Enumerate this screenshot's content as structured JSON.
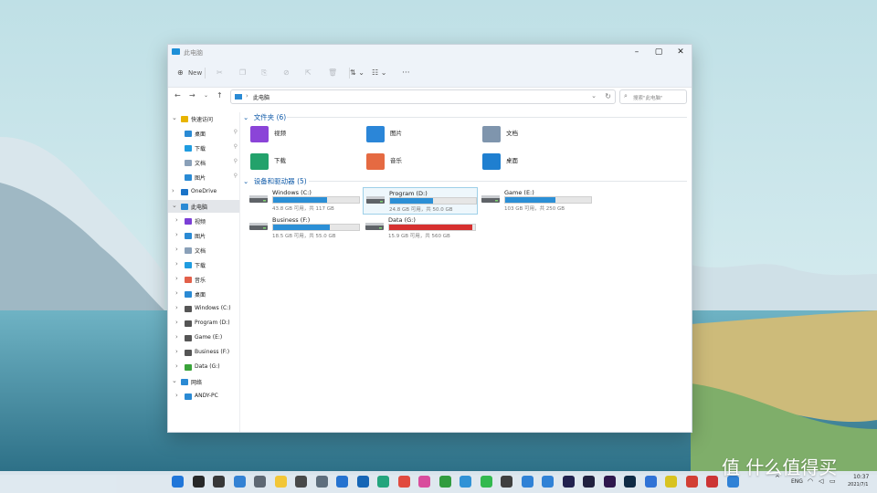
{
  "window": {
    "title": "此电脑"
  },
  "toolbar": {
    "new_label": "New",
    "sort_icon": "sort-icon",
    "view_icon": "view-icon",
    "more_icon": "more-icon"
  },
  "address": {
    "crumb": "此电脑",
    "search_placeholder": "搜索\"此电脑\""
  },
  "sidebar": {
    "items": [
      {
        "label": "快速访问",
        "icon": "star-icon",
        "color": "#e8b400",
        "level": 0,
        "arrow": "v",
        "pin": false,
        "selected": false
      },
      {
        "label": "桌面",
        "icon": "desktop-folder-icon",
        "color": "#2a8ad4",
        "level": 1,
        "arrow": "",
        "pin": true,
        "selected": false
      },
      {
        "label": "下载",
        "icon": "download-icon",
        "color": "#1f9ce0",
        "level": 1,
        "arrow": "",
        "pin": true,
        "selected": false
      },
      {
        "label": "文档",
        "icon": "documents-icon",
        "color": "#8aa0b8",
        "level": 1,
        "arrow": "",
        "pin": true,
        "selected": false
      },
      {
        "label": "图片",
        "icon": "pictures-icon",
        "color": "#2a8ad4",
        "level": 1,
        "arrow": "",
        "pin": true,
        "selected": false
      },
      {
        "label": "OneDrive",
        "icon": "onedrive-icon",
        "color": "#1a73c8",
        "level": 0,
        "arrow": ">",
        "pin": false,
        "selected": false
      },
      {
        "label": "此电脑",
        "icon": "pc-icon",
        "color": "#2a8ad4",
        "level": 0,
        "arrow": "v",
        "pin": false,
        "selected": true
      },
      {
        "label": "视频",
        "icon": "videos-icon",
        "color": "#7b3fd6",
        "level": 1,
        "arrow": ">",
        "pin": false,
        "selected": false
      },
      {
        "label": "图片",
        "icon": "pictures-icon",
        "color": "#2a8ad4",
        "level": 1,
        "arrow": ">",
        "pin": false,
        "selected": false
      },
      {
        "label": "文档",
        "icon": "documents-icon",
        "color": "#8aa0b8",
        "level": 1,
        "arrow": ">",
        "pin": false,
        "selected": false
      },
      {
        "label": "下载",
        "icon": "download-icon",
        "color": "#1f9ce0",
        "level": 1,
        "arrow": ">",
        "pin": false,
        "selected": false
      },
      {
        "label": "音乐",
        "icon": "music-icon",
        "color": "#e2604a",
        "level": 1,
        "arrow": ">",
        "pin": false,
        "selected": false
      },
      {
        "label": "桌面",
        "icon": "desktop-folder-icon",
        "color": "#2a8ad4",
        "level": 1,
        "arrow": ">",
        "pin": false,
        "selected": false
      },
      {
        "label": "Windows (C:)",
        "icon": "drive-icon",
        "color": "#555555",
        "level": 1,
        "arrow": ">",
        "pin": false,
        "selected": false
      },
      {
        "label": "Program (D:)",
        "icon": "drive-icon",
        "color": "#555555",
        "level": 1,
        "arrow": ">",
        "pin": false,
        "selected": false
      },
      {
        "label": "Game (E:)",
        "icon": "drive-icon",
        "color": "#555555",
        "level": 1,
        "arrow": ">",
        "pin": false,
        "selected": false
      },
      {
        "label": "Business (F:)",
        "icon": "drive-icon",
        "color": "#555555",
        "level": 1,
        "arrow": ">",
        "pin": false,
        "selected": false
      },
      {
        "label": "Data (G:)",
        "icon": "drive-icon",
        "color": "#3aa33a",
        "level": 1,
        "arrow": ">",
        "pin": false,
        "selected": false
      },
      {
        "label": "网络",
        "icon": "network-icon",
        "color": "#2a8ad4",
        "level": 0,
        "arrow": "v",
        "pin": false,
        "selected": false
      },
      {
        "label": "ANDY-PC",
        "icon": "computer-icon",
        "color": "#2a8ad4",
        "level": 1,
        "arrow": ">",
        "pin": false,
        "selected": false
      }
    ]
  },
  "folders_section": {
    "title": "文件夹 (6)",
    "items": [
      {
        "label": "视频",
        "icon": "videos-folder-icon",
        "color": "#8b44d8"
      },
      {
        "label": "图片",
        "icon": "pictures-folder-icon",
        "color": "#2b86d8"
      },
      {
        "label": "文档",
        "icon": "documents-folder-icon",
        "color": "#7f95ad"
      },
      {
        "label": "下载",
        "icon": "downloads-folder-icon",
        "color": "#23a26b"
      },
      {
        "label": "音乐",
        "icon": "music-folder-icon",
        "color": "#e56a42"
      },
      {
        "label": "桌面",
        "icon": "desktop-folder-icon",
        "color": "#1f7fd0"
      }
    ]
  },
  "drives_section": {
    "title": "设备和驱动器 (5)",
    "items": [
      {
        "name": "Windows (C:)",
        "sub": "43.8 GB 可用，共 117 GB",
        "used": 0.63,
        "bar_color": "#2b8fd6",
        "icon": "windows-drive-icon",
        "selected": false
      },
      {
        "name": "Program (D:)",
        "sub": "24.8 GB 可用，共 50.0 GB",
        "used": 0.5,
        "bar_color": "#2b8fd6",
        "icon": "drive-icon",
        "selected": true
      },
      {
        "name": "Game (E:)",
        "sub": "103 GB 可用，共 250 GB",
        "used": 0.59,
        "bar_color": "#2b8fd6",
        "icon": "drive-icon",
        "selected": false
      },
      {
        "name": "Business (F:)",
        "sub": "18.5 GB 可用，共 55.0 GB",
        "used": 0.66,
        "bar_color": "#2b8fd6",
        "icon": "drive-icon",
        "selected": false
      },
      {
        "name": "Data (G:)",
        "sub": "15.9 GB 可用，共 560 GB",
        "used": 0.97,
        "bar_color": "#d6302f",
        "icon": "data-drive-icon",
        "selected": false
      }
    ]
  },
  "taskbar": {
    "apps": [
      {
        "icon": "start-icon",
        "color": "#1a73d9"
      },
      {
        "icon": "search-icon",
        "color": "#222222"
      },
      {
        "icon": "task-view-icon",
        "color": "#333333"
      },
      {
        "icon": "widgets-icon",
        "color": "#2e7fd4"
      },
      {
        "icon": "settings-icon",
        "color": "#5a6470"
      },
      {
        "icon": "file-explorer-icon",
        "color": "#f3c532"
      },
      {
        "icon": "notepad-icon",
        "color": "#444444"
      },
      {
        "icon": "store-icon",
        "color": "#5a6a7a"
      },
      {
        "icon": "mail-icon",
        "color": "#1f6fd0"
      },
      {
        "icon": "outlook-icon",
        "color": "#1062b5"
      },
      {
        "icon": "edge-icon",
        "color": "#1da37a"
      },
      {
        "icon": "chrome-icon",
        "color": "#e2463a"
      },
      {
        "icon": "photos-icon",
        "color": "#d9489b"
      },
      {
        "icon": "xbox-icon",
        "color": "#2c9a3a"
      },
      {
        "icon": "translate-icon",
        "color": "#2b8fd6"
      },
      {
        "icon": "wechat-icon",
        "color": "#2db84a"
      },
      {
        "icon": "qq-icon",
        "color": "#3a3a3a"
      },
      {
        "icon": "bluetooth-icon",
        "color": "#2b7fd6"
      },
      {
        "icon": "todo-icon",
        "color": "#2b7fd6"
      },
      {
        "icon": "after-effects-icon",
        "color": "#1c1c4a"
      },
      {
        "icon": "media-encoder-icon",
        "color": "#1b1b3a"
      },
      {
        "icon": "premiere-icon",
        "color": "#2a1248"
      },
      {
        "icon": "photoshop-icon",
        "color": "#0a2540"
      },
      {
        "icon": "bird-app-icon",
        "color": "#2b6fd6"
      },
      {
        "icon": "music-app-icon",
        "color": "#d8c21a"
      },
      {
        "icon": "netease-icon",
        "color": "#d23a2e"
      },
      {
        "icon": "game-icon",
        "color": "#cc2f2f"
      },
      {
        "icon": "phone-icon",
        "color": "#2b7fd6"
      }
    ],
    "tray": {
      "chevron": "^",
      "lang": "ENG",
      "time": "10:37",
      "date": "2021/7/1"
    }
  },
  "watermark": {
    "text": "值 什么值得买"
  }
}
